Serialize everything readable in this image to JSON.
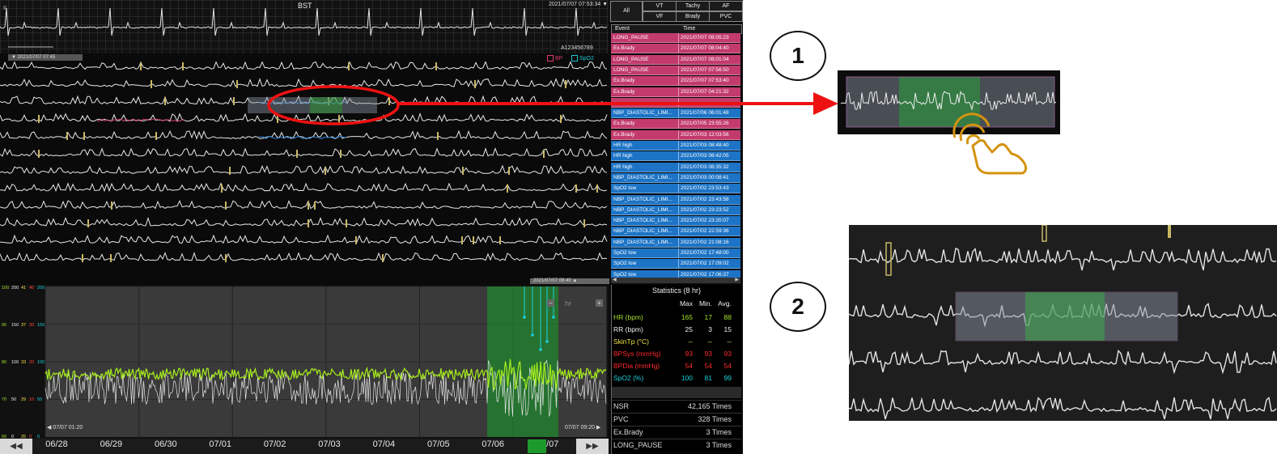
{
  "monitor": {
    "top_strip": {
      "label": "BST",
      "timestamp": "2021/07/07 07:53:34 ▼",
      "patient_id": "A123456789",
      "date_tag": "▼ 2021/07/07 07:45"
    },
    "legend": {
      "bp": "BP",
      "spo2": "SpO2"
    },
    "filters": {
      "all": "All",
      "vt": "VT",
      "tachy": "Tachy",
      "af": "AF",
      "vf": "VF",
      "brady": "Brady",
      "pvc": "PVC"
    },
    "events_header": {
      "event": "Event",
      "time": "Time"
    },
    "events": [
      {
        "event": "LONG_PAUSE",
        "time": "2021/07/07 08:05:23",
        "type": "pink"
      },
      {
        "event": "Ex.Brady",
        "time": "2021/07/07 08:04:40",
        "type": "pink"
      },
      {
        "event": "LONG_PAUSE",
        "time": "2021/07/07 08:01:04",
        "type": "pink"
      },
      {
        "event": "LONG_PAUSE",
        "time": "2021/07/07 07:56:50",
        "type": "pink"
      },
      {
        "event": "Ex.Brady",
        "time": "2021/07/07 07:53:40",
        "type": "pink"
      },
      {
        "event": "Ex.Brady",
        "time": "2021/07/07 04:21:32",
        "type": "pink"
      },
      {
        "event": "",
        "time": "",
        "type": "pink"
      },
      {
        "event": "NBP_DIASTOLIC_LIMI...",
        "time": "2021/07/06 06:01:48",
        "type": "blue"
      },
      {
        "event": "Ex.Brady",
        "time": "2021/07/05 23:55:26",
        "type": "pink"
      },
      {
        "event": "Ex.Brady",
        "time": "2021/07/03 12:03:56",
        "type": "pink"
      },
      {
        "event": "HR high",
        "time": "2021/07/03 08:48:40",
        "type": "blue"
      },
      {
        "event": "HR high",
        "time": "2021/07/03 08:42:05",
        "type": "blue"
      },
      {
        "event": "HR high",
        "time": "2021/07/03 08:35:32",
        "type": "blue"
      },
      {
        "event": "NBP_DIASTOLIC_LIMI...",
        "time": "2021/07/03 00:08:41",
        "type": "blue"
      },
      {
        "event": "SpO2 low",
        "time": "2021/07/02 23:53:43",
        "type": "blue"
      },
      {
        "event": "NBP_DIASTOLIC_LIMI...",
        "time": "2021/07/02 23:43:58",
        "type": "blue"
      },
      {
        "event": "NBP_DIASTOLIC_LIMI...",
        "time": "2021/07/02 23:23:52",
        "type": "blue"
      },
      {
        "event": "NBP_DIASTOLIC_LIMI...",
        "time": "2021/07/02 23:20:07",
        "type": "blue"
      },
      {
        "event": "NBP_DIASTOLIC_LIMI...",
        "time": "2021/07/02 22:59:36",
        "type": "blue"
      },
      {
        "event": "NBP_DIASTOLIC_LIMI...",
        "time": "2021/07/02 21:08:16",
        "type": "blue"
      },
      {
        "event": "SpO2 low",
        "time": "2021/07/02 17:48:00",
        "type": "blue"
      },
      {
        "event": "SpO2 low",
        "time": "2021/07/02 17:09:02",
        "type": "blue"
      },
      {
        "event": "SpO2 low",
        "time": "2021/07/02 17:06:37",
        "type": "blue"
      }
    ],
    "trend": {
      "date_tag": "2021/07/07 08:40 ▲",
      "start_label": "◀ 07/07 01:20",
      "end_label": "07/07 09:20 ▶",
      "zoom_unit": "hr",
      "y_scales": [
        {
          "hr": "100",
          "rr": "200",
          "tp": "41",
          "bp": "40",
          "sp": "200"
        },
        {
          "hr": "90",
          "rr": "150",
          "tp": "37",
          "bp": "30",
          "sp": "150"
        },
        {
          "hr": "80",
          "rr": "100",
          "tp": "33",
          "bp": "20",
          "sp": "100"
        },
        {
          "hr": "70",
          "rr": "50",
          "tp": "29",
          "bp": "10",
          "sp": "50"
        },
        {
          "hr": "60",
          "rr": "0",
          "tp": "25",
          "bp": "0",
          "sp": "0"
        }
      ]
    },
    "statistics": {
      "title": "Statistics (8 hr)",
      "col_max": "Max",
      "col_min": "Min.",
      "col_avg": "Avg.",
      "rows": [
        {
          "label": "HR (bpm)",
          "max": "165",
          "min": "17",
          "avg": "88",
          "color": "#a6e22e"
        },
        {
          "label": "RR (bpm)",
          "max": "25",
          "min": "3",
          "avg": "15",
          "color": "#f0f0f0"
        },
        {
          "label": "SkinTp (°C)",
          "max": "--",
          "min": "--",
          "avg": "--",
          "color": "#f2e34a"
        },
        {
          "label": "BPSys (mmHg)",
          "max": "93",
          "min": "93",
          "avg": "93",
          "color": "#ff2a2a"
        },
        {
          "label": "BPDia (mmHg)",
          "max": "54",
          "min": "54",
          "avg": "54",
          "color": "#ff2a2a"
        },
        {
          "label": "SpO2 (%)",
          "max": "100",
          "min": "81",
          "avg": "99",
          "color": "#19d3e0"
        }
      ],
      "counts": [
        {
          "label": "NSR",
          "value": "42,165 Times"
        },
        {
          "label": "PVC",
          "value": "328 Times"
        },
        {
          "label": "Ex.Brady",
          "value": "3 Times"
        },
        {
          "label": "LONG_PAUSE",
          "value": "3 Times"
        }
      ]
    },
    "timeline": {
      "prev": "◀◀",
      "next": "▶▶",
      "days": [
        "06/28",
        "06/29",
        "06/30",
        "07/01",
        "07/02",
        "07/03",
        "07/04",
        "07/05",
        "07/06",
        "07/07"
      ]
    }
  },
  "annotations": {
    "badge1": "1",
    "badge2": "2"
  },
  "colors": {
    "pink": "#c23b6c",
    "blue": "#1d74c6",
    "arrow": "#ee1111",
    "hand": "#d4930f",
    "hr_trace": "#a6ec1e"
  },
  "icons": {
    "hand": "hand-tap-icon",
    "arrow": "right-arrow-icon"
  }
}
